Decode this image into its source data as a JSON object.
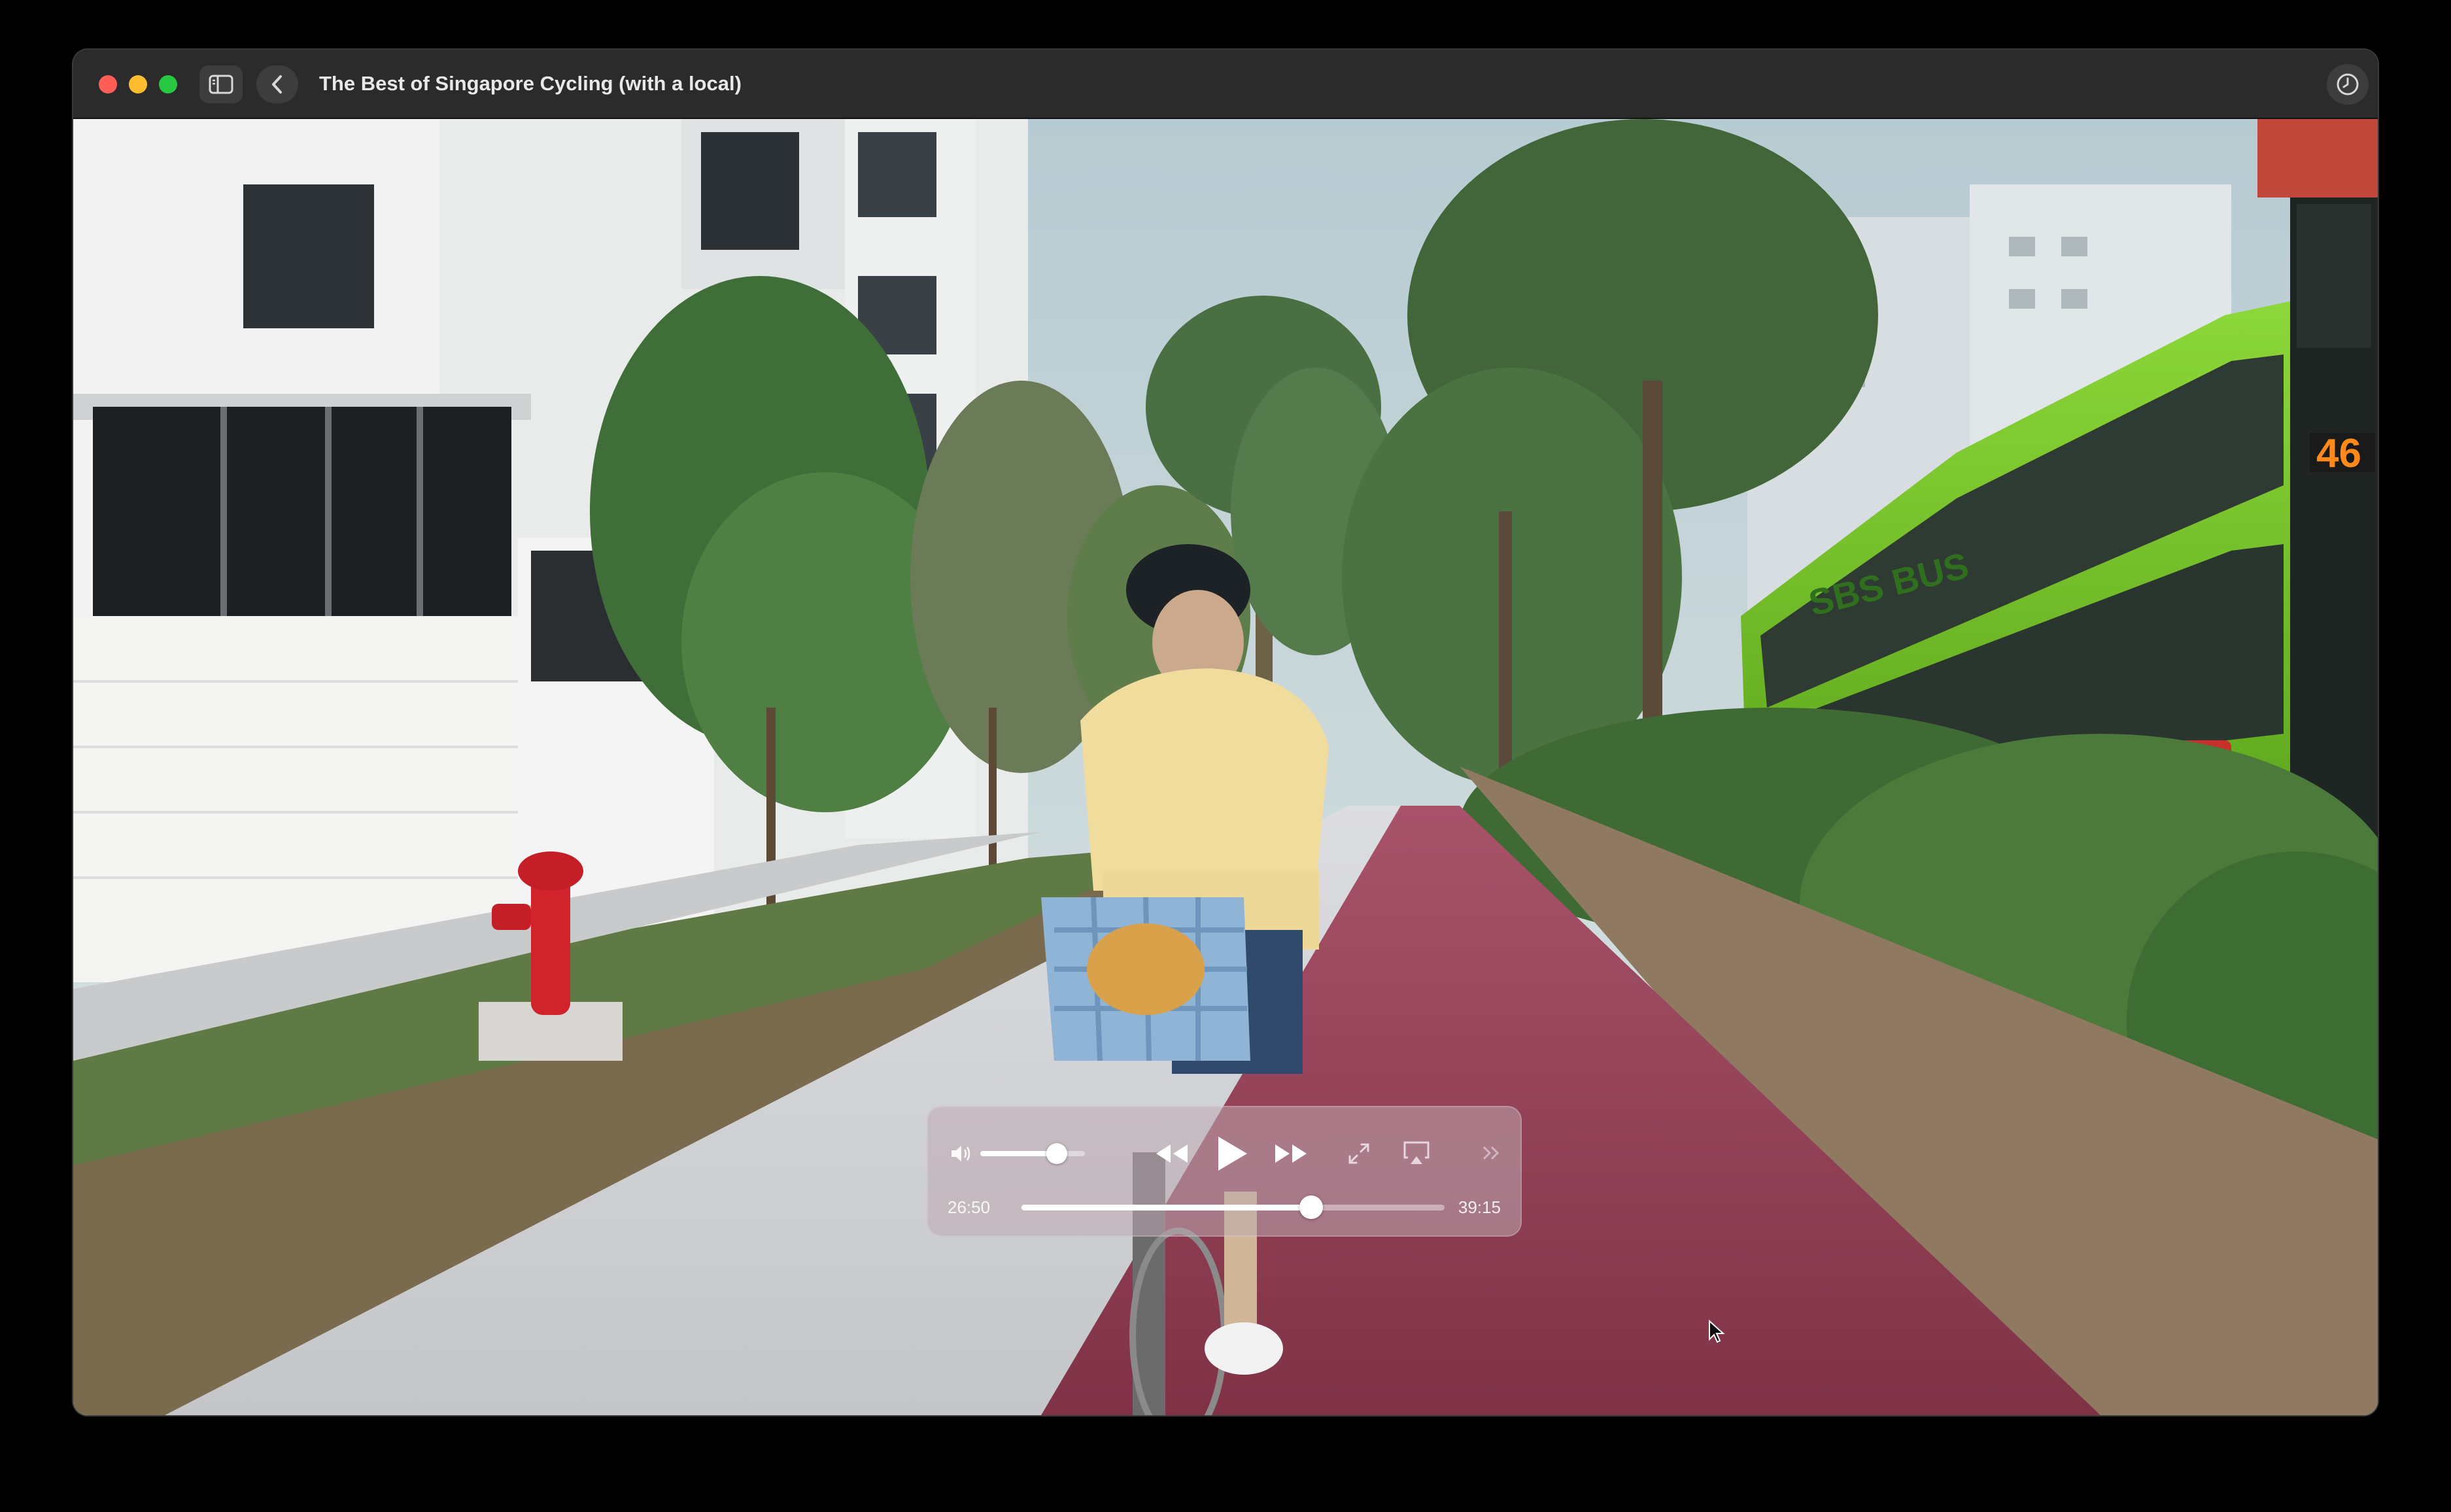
{
  "window": {
    "title": "The Best of Singapore Cycling (with a local)",
    "buttons": {
      "close": "close-button",
      "minimize": "minimize-button",
      "zoom": "zoom-button",
      "sidebar": "sidebar-icon",
      "back": "chevron-left-icon",
      "history": "clock-icon"
    }
  },
  "video": {
    "scene_text": {
      "bus_route": "46",
      "bus_brand": "SBS BUS"
    }
  },
  "player": {
    "elapsed": "26:50",
    "duration": "39:15",
    "progress": 0.684,
    "volume": 0.73,
    "icons": {
      "volume": "speaker-icon",
      "rewind": "rewind-icon",
      "play": "play-icon",
      "fast_forward": "fast-forward-icon",
      "fullscreen": "fullscreen-icon",
      "airplay": "airplay-icon",
      "skip": "skip-forward-icon"
    }
  },
  "colors": {
    "close": "#ff5f57",
    "minimize": "#febc2e",
    "zoom": "#28c840",
    "bike_lane": "#8b3a4f",
    "bus_green": "#7cc82a"
  }
}
